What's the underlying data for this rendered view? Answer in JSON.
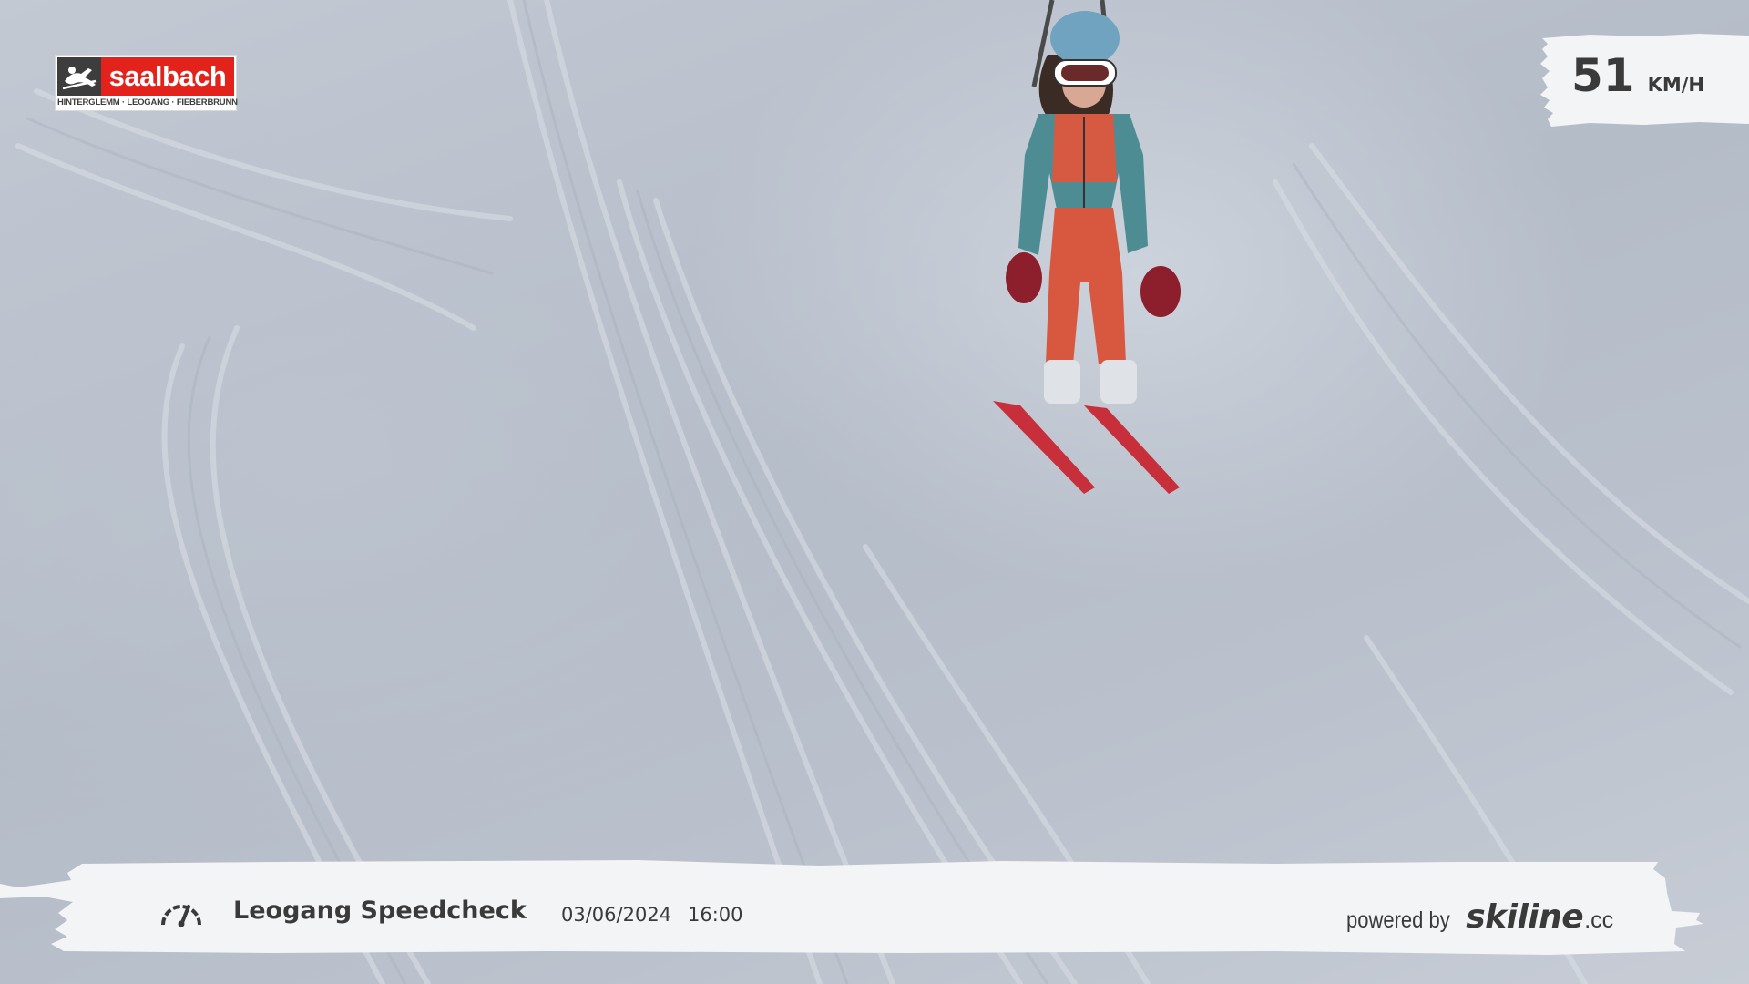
{
  "logo": {
    "brand": "saalbach",
    "subtitle": "HINTERGLEMM · LEOGANG · FIEBERBRUNN"
  },
  "speed": {
    "value": "51",
    "unit": "KM/H"
  },
  "camera": {
    "title": "Leogang Speedcheck",
    "date": "03/06/2024",
    "time": "16:00"
  },
  "attribution": {
    "prefix": "powered by",
    "brand": "skiline",
    "tld": ".cc"
  },
  "icons": {
    "logo_emblem": "skier-emblem-icon",
    "speed": "speedometer-icon"
  },
  "colors": {
    "brand_red": "#e3231b",
    "text_dark": "#3a3a3a",
    "banner_white": "#f3f4f6"
  }
}
